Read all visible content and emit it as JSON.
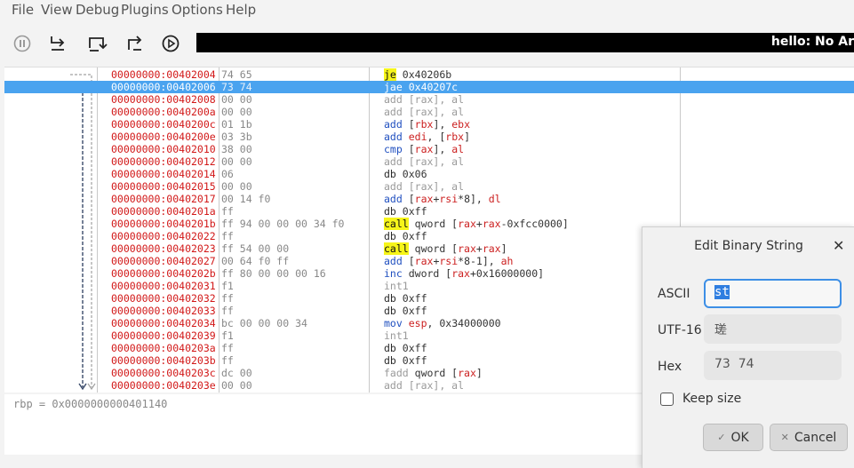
{
  "menu": [
    "File",
    "View",
    "Debug",
    "Plugins",
    "Options",
    "Help"
  ],
  "toolbar": {
    "buttons": [
      "pause-icon",
      "step-into-icon",
      "step-over-icon",
      "step-out-icon",
      "run-icon"
    ],
    "status": "hello: No Ar"
  },
  "disasm": {
    "selected_index": 1,
    "rows": [
      {
        "addr": "00000000:00402004",
        "bytes": "74 65",
        "mnemonic": "je",
        "mn_style": "hl",
        "operands": "0x40206b",
        "op_style": "plain"
      },
      {
        "addr": "00000000:00402006",
        "bytes": "73 74",
        "mnemonic": "jae",
        "mn_style": "plain",
        "operands": "0x40207c",
        "op_style": "plain"
      },
      {
        "addr": "00000000:00402008",
        "bytes": "00 00",
        "mnemonic": "add",
        "mn_style": "gray",
        "operands": "[rax], al",
        "op_style": "gray"
      },
      {
        "addr": "00000000:0040200a",
        "bytes": "00 00",
        "mnemonic": "add",
        "mn_style": "gray",
        "operands": "[rax], al",
        "op_style": "gray"
      },
      {
        "addr": "00000000:0040200c",
        "bytes": "01 1b",
        "mnemonic": "add",
        "mn_style": "blue",
        "operands": "[rbx], ebx",
        "op_style": "reg"
      },
      {
        "addr": "00000000:0040200e",
        "bytes": "03 3b",
        "mnemonic": "add",
        "mn_style": "blue",
        "operands": "edi, [rbx]",
        "op_style": "reg"
      },
      {
        "addr": "00000000:00402010",
        "bytes": "38 00",
        "mnemonic": "cmp",
        "mn_style": "blue",
        "operands": "[rax], al",
        "op_style": "reg"
      },
      {
        "addr": "00000000:00402012",
        "bytes": "00 00",
        "mnemonic": "add",
        "mn_style": "gray",
        "operands": "[rax], al",
        "op_style": "gray"
      },
      {
        "addr": "00000000:00402014",
        "bytes": "06",
        "mnemonic": "db",
        "mn_style": "plain",
        "operands": "0x06",
        "op_style": "plain"
      },
      {
        "addr": "00000000:00402015",
        "bytes": "00 00",
        "mnemonic": "add",
        "mn_style": "gray",
        "operands": "[rax], al",
        "op_style": "gray"
      },
      {
        "addr": "00000000:00402017",
        "bytes": "00 14 f0",
        "mnemonic": "add",
        "mn_style": "blue",
        "operands": "[rax+rsi*8], dl",
        "op_style": "reg"
      },
      {
        "addr": "00000000:0040201a",
        "bytes": "ff",
        "mnemonic": "db",
        "mn_style": "plain",
        "operands": "0xff",
        "op_style": "plain"
      },
      {
        "addr": "00000000:0040201b",
        "bytes": "ff 94 00 00 00 34 f0",
        "mnemonic": "call",
        "mn_style": "hl",
        "operands": "qword [rax+rax-0xfcc0000]",
        "op_style": "reg"
      },
      {
        "addr": "00000000:00402022",
        "bytes": "ff",
        "mnemonic": "db",
        "mn_style": "plain",
        "operands": "0xff",
        "op_style": "plain"
      },
      {
        "addr": "00000000:00402023",
        "bytes": "ff 54 00 00",
        "mnemonic": "call",
        "mn_style": "hl",
        "operands": "qword [rax+rax]",
        "op_style": "reg"
      },
      {
        "addr": "00000000:00402027",
        "bytes": "00 64 f0 ff",
        "mnemonic": "add",
        "mn_style": "blue",
        "operands": "[rax+rsi*8-1], ah",
        "op_style": "reg"
      },
      {
        "addr": "00000000:0040202b",
        "bytes": "ff 80 00 00 00 16",
        "mnemonic": "inc",
        "mn_style": "blue",
        "operands": "dword [rax+0x16000000]",
        "op_style": "reg"
      },
      {
        "addr": "00000000:00402031",
        "bytes": "f1",
        "mnemonic": "int1",
        "mn_style": "gray",
        "operands": "",
        "op_style": "plain"
      },
      {
        "addr": "00000000:00402032",
        "bytes": "ff",
        "mnemonic": "db",
        "mn_style": "plain",
        "operands": "0xff",
        "op_style": "plain"
      },
      {
        "addr": "00000000:00402033",
        "bytes": "ff",
        "mnemonic": "db",
        "mn_style": "plain",
        "operands": "0xff",
        "op_style": "plain"
      },
      {
        "addr": "00000000:00402034",
        "bytes": "bc 00 00 00 34",
        "mnemonic": "mov",
        "mn_style": "blue",
        "operands": "esp, 0x34000000",
        "op_style": "reg"
      },
      {
        "addr": "00000000:00402039",
        "bytes": "f1",
        "mnemonic": "int1",
        "mn_style": "gray",
        "operands": "",
        "op_style": "plain"
      },
      {
        "addr": "00000000:0040203a",
        "bytes": "ff",
        "mnemonic": "db",
        "mn_style": "plain",
        "operands": "0xff",
        "op_style": "plain"
      },
      {
        "addr": "00000000:0040203b",
        "bytes": "ff",
        "mnemonic": "db",
        "mn_style": "plain",
        "operands": "0xff",
        "op_style": "plain"
      },
      {
        "addr": "00000000:0040203c",
        "bytes": "dc 00",
        "mnemonic": "fadd",
        "mn_style": "gray",
        "operands": "qword [rax]",
        "op_style": "reg"
      },
      {
        "addr": "00000000:0040203e",
        "bytes": "00 00",
        "mnemonic": "add",
        "mn_style": "gray",
        "operands": "[rax], al",
        "op_style": "gray"
      }
    ]
  },
  "registers": {
    "line": "rbp = 0x0000000000401140"
  },
  "dialog": {
    "title": "Edit Binary String",
    "close_icon": "close-icon",
    "ascii_label": "ASCII",
    "ascii_value": "st",
    "utf16_label": "UTF-16",
    "utf16_value": "瑳",
    "hex_label": "Hex",
    "hex_value": "73  74",
    "keep_size_label": "Keep size",
    "keep_size_checked": false,
    "ok_label": "OK",
    "ok_icon": "check-icon",
    "cancel_label": "Cancel",
    "cancel_icon": "cross-icon"
  }
}
